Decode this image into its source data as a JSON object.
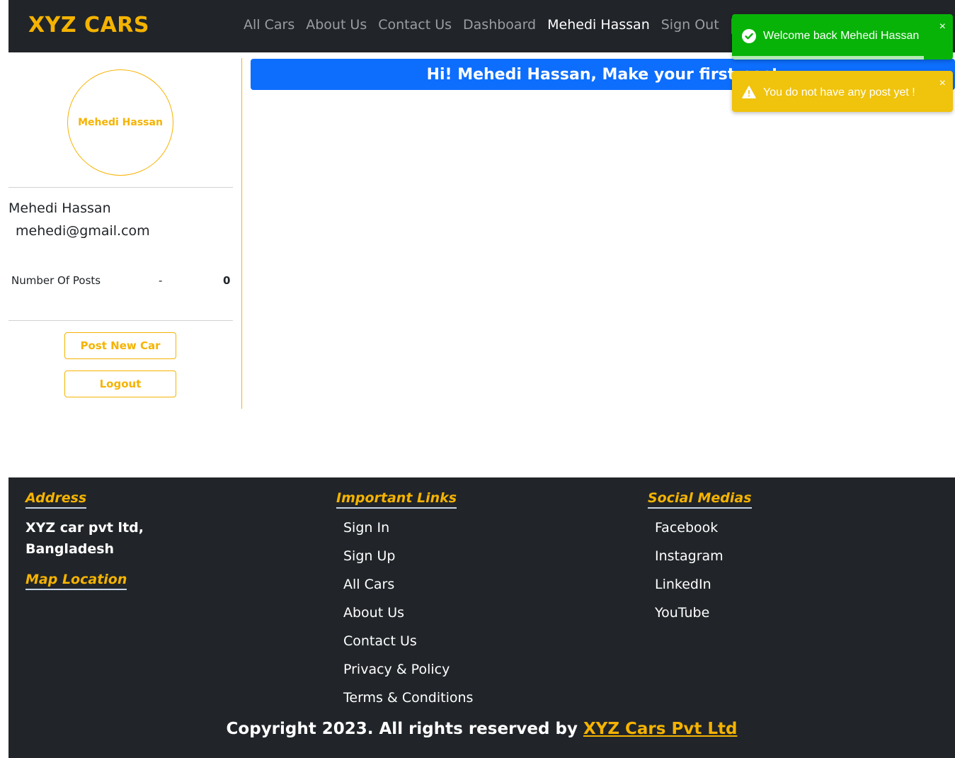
{
  "navbar": {
    "brand": "XYZ CARS",
    "links": [
      {
        "label": "All Cars"
      },
      {
        "label": "About Us"
      },
      {
        "label": "Contact Us"
      },
      {
        "label": "Dashboard"
      },
      {
        "label": "Mehedi Hassan"
      },
      {
        "label": "Sign Out"
      }
    ]
  },
  "toasts": {
    "success": {
      "message": "Welcome back Mehedi Hassan",
      "close": "×",
      "icon": "check-circle-icon",
      "color": "#08b308",
      "progress": 0.87
    },
    "warning": {
      "message": "You do not have any post yet !",
      "close": "×",
      "icon": "warning-triangle-icon",
      "color": "#f0c30c"
    }
  },
  "sidebar": {
    "avatar_text": "Mehedi Hassan",
    "name": "Mehedi Hassan",
    "email": "mehedi@gmail.com",
    "stat_label": "Number Of Posts",
    "stat_separator": "-",
    "stat_value": "0",
    "post_button": "Post New Car",
    "logout_button": "Logout"
  },
  "main": {
    "banner": "Hi! Mehedi Hassan, Make your first post"
  },
  "footer": {
    "address_heading": "Address",
    "address_line1": "XYZ car pvt ltd,",
    "address_line2": "Bangladesh",
    "map_heading": "Map Location",
    "links_heading": "Important Links",
    "links": [
      "Sign In",
      "Sign Up",
      "All Cars",
      "About Us",
      "Contact Us",
      "Privacy & Policy",
      "Terms & Conditions"
    ],
    "social_heading": "Social Medias",
    "social": [
      "Facebook",
      "Instagram",
      "LinkedIn",
      "YouTube"
    ],
    "copyright_prefix": "Copyright 2023. All rights reserved by ",
    "copyright_company": "XYZ Cars Pvt Ltd"
  },
  "colors": {
    "accent": "#f5b301",
    "dark": "#212529",
    "primary": "#0d6efd"
  }
}
